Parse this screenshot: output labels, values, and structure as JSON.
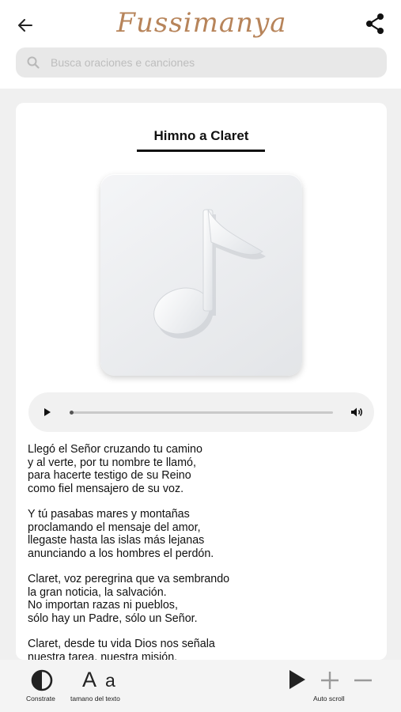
{
  "header": {
    "app_name": "Fussimanya",
    "back_icon": "arrow-left-icon",
    "share_icon": "share-icon"
  },
  "search": {
    "placeholder": "Busca oraciones e canciones",
    "value": ""
  },
  "song": {
    "title": "Himno a Claret",
    "artwork_icon": "music-note-icon"
  },
  "player": {
    "play_icon": "play-icon",
    "volume_icon": "volume-icon",
    "progress": 0
  },
  "lyrics": {
    "stanzas": [
      [
        "Llegó el Señor cruzando tu camino",
        "y al verte, por tu nombre te llamó,",
        "para hacerte testigo de su Reino",
        "como fiel mensajero de su voz."
      ],
      [
        "Y tú pasabas mares y montañas",
        "proclamando el mensaje del amor,",
        "llegaste hasta las islas más lejanas",
        "anunciando a los hombres el perdón."
      ],
      [
        "Claret, voz peregrina que va sembrando",
        "la gran noticia, la salvación.",
        "No importan razas ni pueblos,",
        "sólo hay un Padre, sólo un Señor."
      ],
      [
        "Claret, desde tu vida Dios nos señala",
        "nuestra tarea, nuestra misión."
      ]
    ]
  },
  "toolbar": {
    "contrast_label": "Constrate",
    "text_size_label": "tamano del texto",
    "text_size_big": "A",
    "text_size_small": "a",
    "auto_scroll_label": "Auto scroll",
    "contrast_icon": "contrast-icon",
    "play_icon": "play-icon",
    "plus_icon": "plus-icon",
    "minus_icon": "minus-icon"
  },
  "colors": {
    "brand": "#b7845a",
    "card_bg": "#ffffff",
    "page_bg": "#f0f0f0"
  }
}
